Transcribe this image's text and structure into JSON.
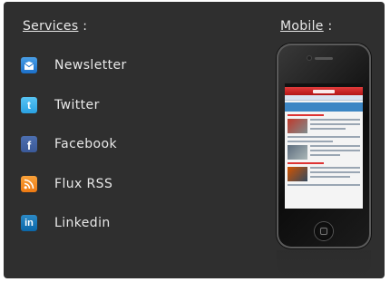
{
  "services": {
    "heading": "Services",
    "heading_suffix": " :",
    "items": [
      {
        "label": "Newsletter",
        "icon": "newsletter-icon"
      },
      {
        "label": "Twitter",
        "icon": "twitter-icon"
      },
      {
        "label": "Facebook",
        "icon": "facebook-icon"
      },
      {
        "label": "Flux RSS",
        "icon": "rss-icon"
      },
      {
        "label": "Linkedin",
        "icon": "linkedin-icon"
      }
    ]
  },
  "mobile": {
    "heading": "Mobile",
    "heading_suffix": " :"
  },
  "colors": {
    "panel_bg": "#2f2f2f",
    "text": "#e8e8e8",
    "newsletter": "#1b6fc9",
    "twitter": "#2aa1e2",
    "facebook": "#3b5998",
    "rss": "#ee7a12",
    "linkedin": "#0a66a8"
  }
}
